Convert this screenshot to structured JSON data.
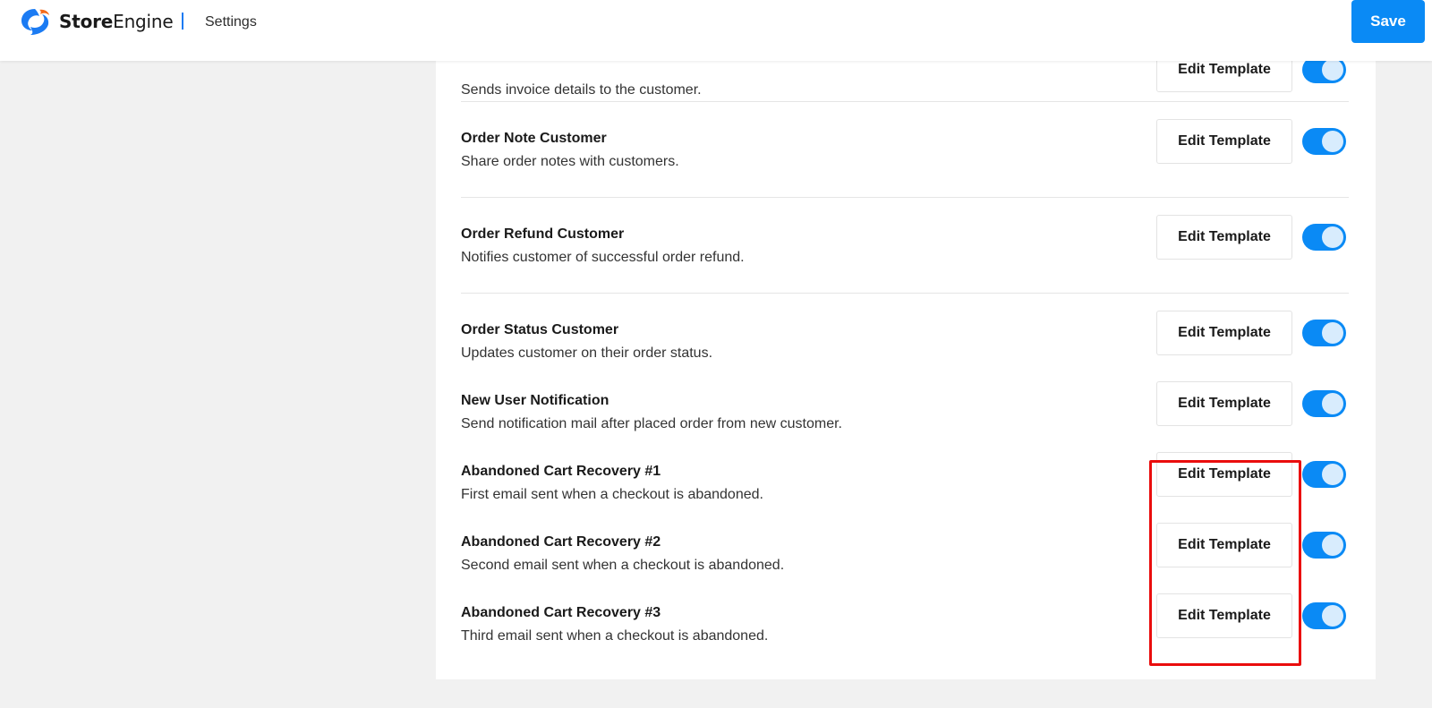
{
  "header": {
    "brand_bold": "Store",
    "brand_light": "Engine",
    "page_title": "Settings",
    "save_label": "Save"
  },
  "colors": {
    "accent": "#0a8af5",
    "highlight": "#ea0d0d",
    "background": "#f1f1f1"
  },
  "notifications": [
    {
      "title": "",
      "desc": "Sends invoice details to the customer.",
      "button": "Edit Template",
      "enabled": true
    },
    {
      "title": "Order Note Customer",
      "desc": "Share order notes with customers.",
      "button": "Edit Template",
      "enabled": true
    },
    {
      "title": "Order Refund Customer",
      "desc": "Notifies customer of successful order refund.",
      "button": "Edit Template",
      "enabled": true
    },
    {
      "title": "Order Status Customer",
      "desc": "Updates customer on their order status.",
      "button": "Edit Template",
      "enabled": true
    },
    {
      "title": "New User Notification",
      "desc": "Send notification mail after placed order from new customer.",
      "button": "Edit Template",
      "enabled": true
    },
    {
      "title": "Abandoned Cart Recovery #1",
      "desc": "First email sent when a checkout is abandoned.",
      "button": "Edit Template",
      "enabled": true
    },
    {
      "title": "Abandoned Cart Recovery #2",
      "desc": "Second email sent when a checkout is abandoned.",
      "button": "Edit Template",
      "enabled": true
    },
    {
      "title": "Abandoned Cart Recovery #3",
      "desc": "Third email sent when a checkout is abandoned.",
      "button": "Edit Template",
      "enabled": true
    }
  ]
}
